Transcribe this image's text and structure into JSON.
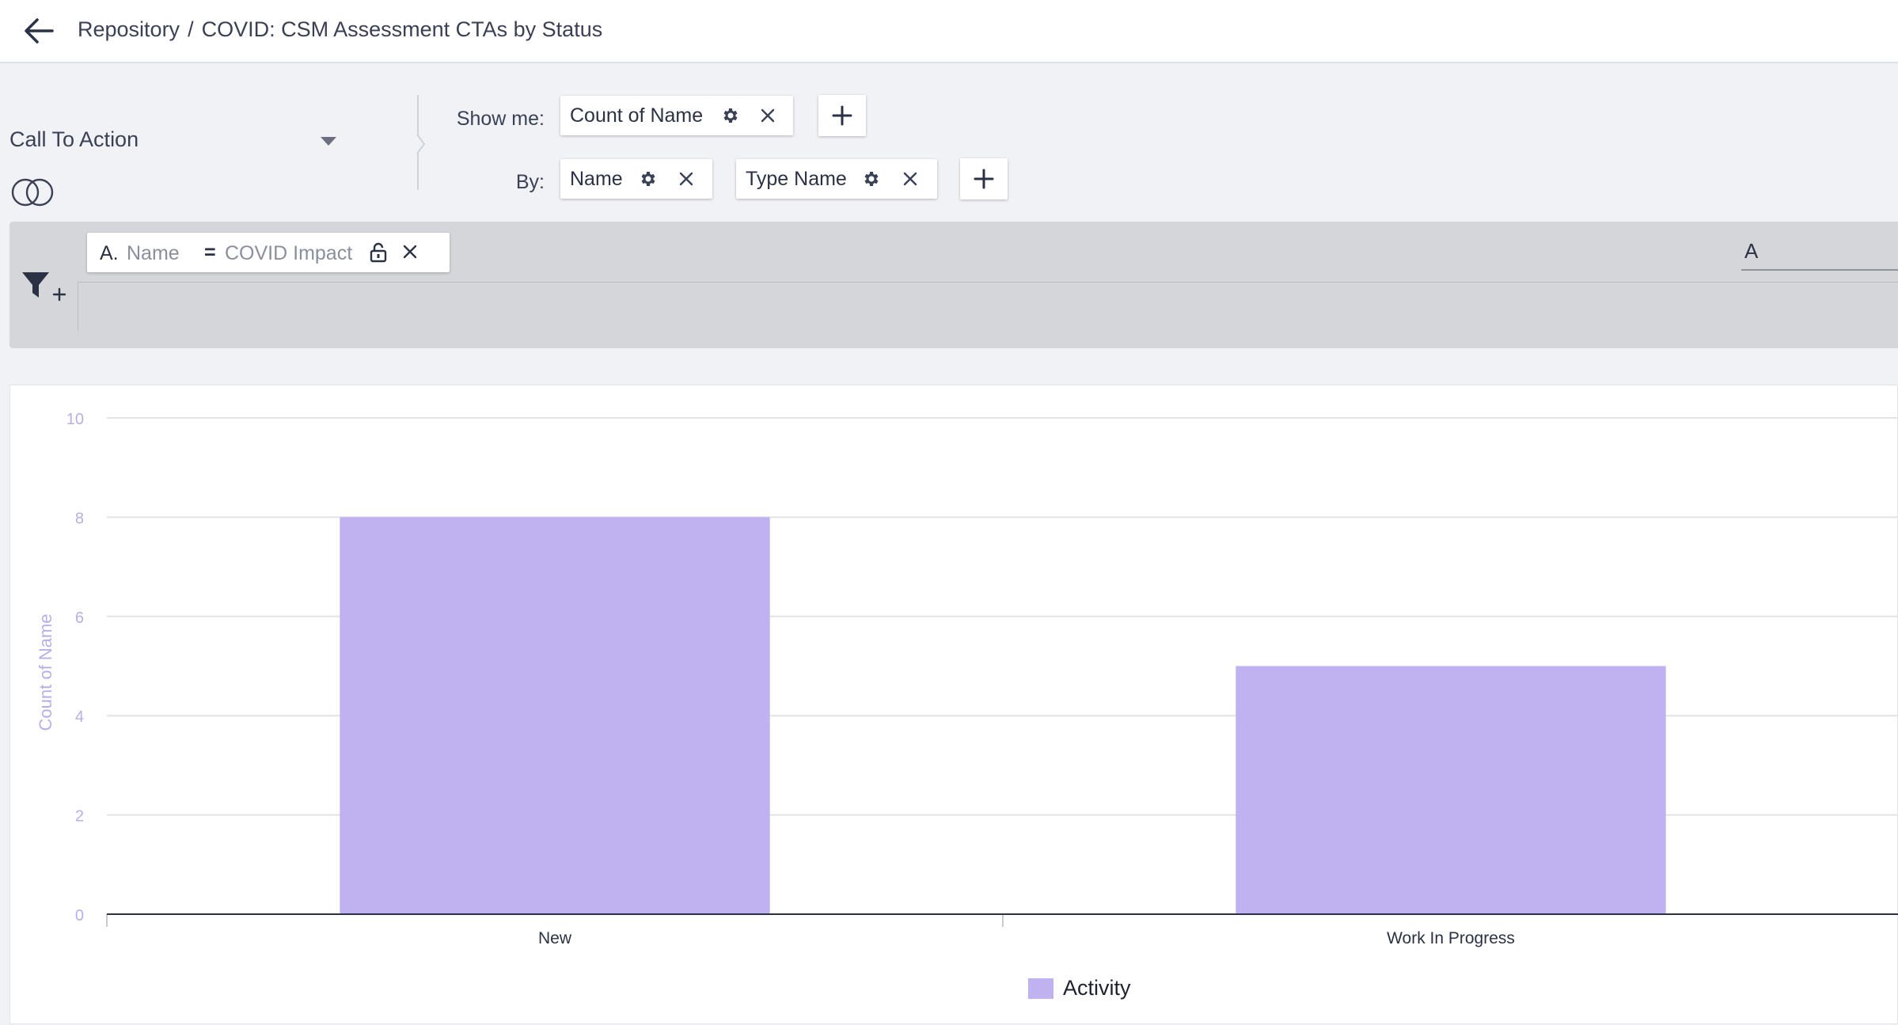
{
  "header": {
    "breadcrumb_root": "Repository",
    "breadcrumb_separator": "/",
    "report_title": "COVID: CSM Assessment CTAs by Status"
  },
  "source": {
    "object_label": "Call To Action"
  },
  "show_me": {
    "label": "Show me:",
    "measures": [
      {
        "label": "Count of Name"
      }
    ]
  },
  "by": {
    "label": "By:",
    "dimensions": [
      {
        "label": "Name"
      },
      {
        "label": "Type Name"
      }
    ]
  },
  "filters": {
    "items": [
      {
        "letter": "A.",
        "field": "Name",
        "operator": "=",
        "value": "COVID Impact"
      }
    ],
    "logic_value": "A"
  },
  "colors": {
    "bar": "#c0b2f0",
    "axis_text": "#b8aee8",
    "grid": "#e2e3e6"
  },
  "chart_data": {
    "type": "bar",
    "categories": [
      "New",
      "Work In Progress"
    ],
    "series": [
      {
        "name": "Activity",
        "values": [
          8,
          5
        ]
      }
    ],
    "ylabel": "Count of Name",
    "yticks": [
      "0",
      "2",
      "4",
      "6",
      "8",
      "10"
    ],
    "ylim": [
      0,
      10
    ],
    "grid": true,
    "legend": "bottom-center"
  }
}
